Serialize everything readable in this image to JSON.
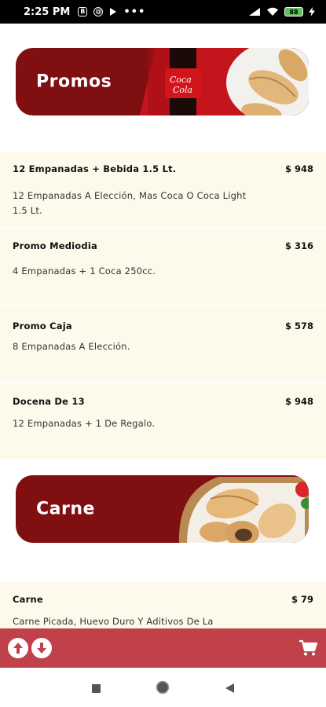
{
  "status_bar": {
    "time": "2:25 PM",
    "battery": "88"
  },
  "sections": [
    {
      "banner_title": "Promos",
      "items": [
        {
          "title": "12 Empanadas + Bebida 1.5 Lt.",
          "price": "$ 948",
          "desc": "12 Empanadas A Elección, Mas Coca O Coca Light 1.5 Lt."
        },
        {
          "title": "Promo Mediodia",
          "price": "$ 316",
          "desc": "4 Empanadas + 1 Coca 250cc."
        },
        {
          "title": "Promo Caja",
          "price": "$ 578",
          "desc": "8 Empanadas A Elección."
        },
        {
          "title": "Docena De 13",
          "price": "$ 948",
          "desc": "12 Empanadas + 1 De Regalo."
        }
      ]
    },
    {
      "banner_title": "Carne",
      "items": [
        {
          "title": "Carne",
          "price": "$ 79",
          "desc": "Carne Picada, Huevo Duro Y Aditivos De La Cocina Criolla."
        }
      ]
    }
  ],
  "colors": {
    "banner": "#800f12",
    "item_bg": "#fdfaeb",
    "bottom_bar": "#c1414a"
  },
  "icons": {
    "scroll_up": "arrow-up-icon",
    "scroll_down": "arrow-down-icon",
    "cart": "cart-icon",
    "nav_recents": "square-icon",
    "nav_home": "circle-icon",
    "nav_back": "triangle-icon"
  }
}
